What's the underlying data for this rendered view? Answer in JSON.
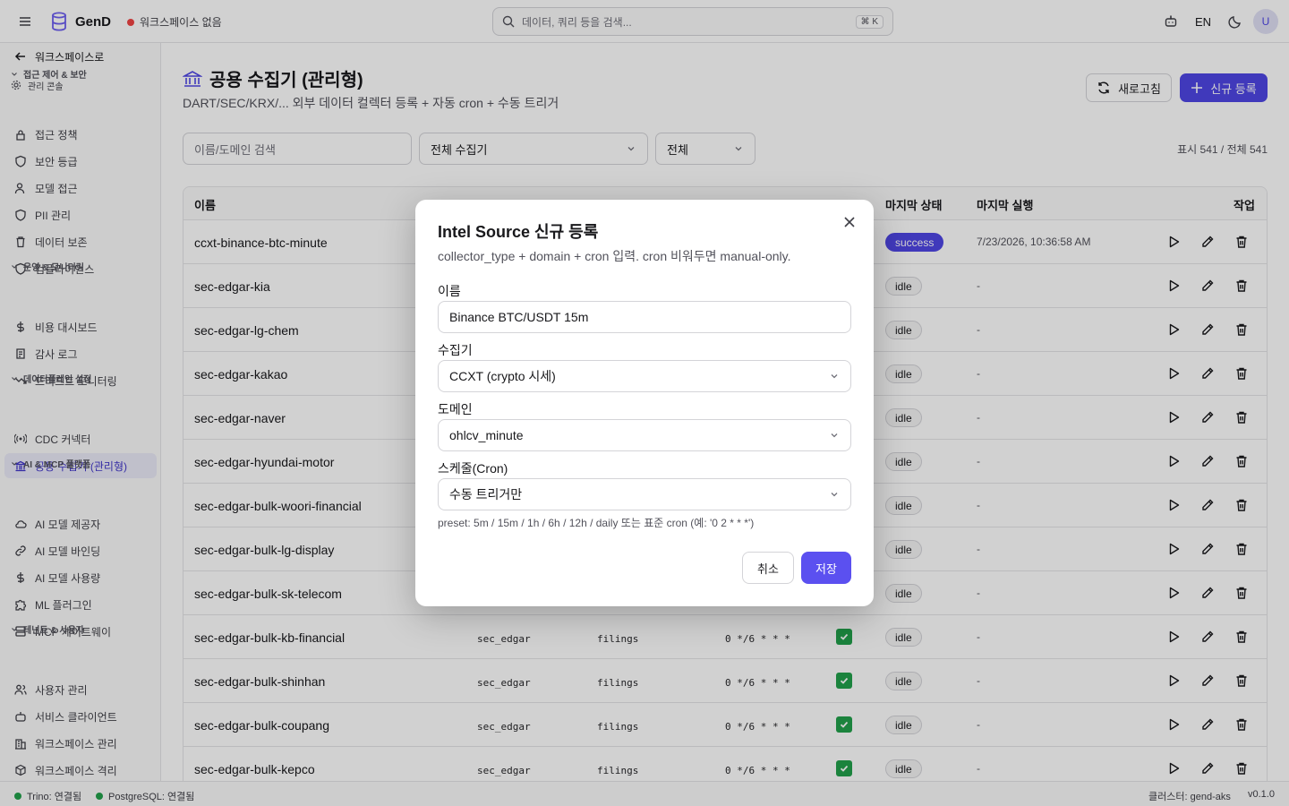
{
  "topbar": {
    "brand": "GenD",
    "workspace": "워크스페이스 없음",
    "search_placeholder": "데이터, 쿼리 등을 검색...",
    "search_shortcut": "⌘ K",
    "lang": "EN",
    "avatar": "U"
  },
  "sidebar": {
    "back": "워크스페이스로",
    "admin_console": "관리 콘솔",
    "sections": [
      {
        "title": "접근 제어 & 보안",
        "items": [
          "접근 정책",
          "보안 등급",
          "모델 접근",
          "PII 관리",
          "데이터 보존",
          "컴플라이언스"
        ]
      },
      {
        "title": "운영 & 모니터링",
        "items": [
          "비용 대시보드",
          "감사 로그",
          "드리프트 모니터링"
        ]
      },
      {
        "title": "데이터플레인 설정",
        "items": [
          "CDC 커넥터",
          "공용 수집기 (관리형)"
        ]
      },
      {
        "title": "AI & MCP 플랫폼",
        "items": [
          "AI 모델 제공자",
          "AI 모델 바인딩",
          "AI 모델 사용량",
          "ML 플러그인",
          "MCP 게이트웨이"
        ]
      },
      {
        "title": "테넌트 & 사용자",
        "items": [
          "사용자 관리",
          "서비스 클라이언트",
          "워크스페이스 관리",
          "워크스페이스 격리"
        ]
      }
    ]
  },
  "page": {
    "title": "공용 수집기 (관리형)",
    "subtitle": "DART/SEC/KRX/... 외부 데이터 컬렉터 등록 + 자동 cron + 수동 트리거",
    "refresh": "새로고침",
    "new": "신규 등록",
    "filter_search_placeholder": "이름/도메인 검색",
    "filter_collector": "전체 수집기",
    "filter_status": "전체",
    "count": "표시 541 / 전체 541"
  },
  "table": {
    "headers": [
      "이름",
      "마지막 상태",
      "마지막 실행",
      "작업"
    ],
    "rows": [
      {
        "name": "ccxt-binance-btc-minute",
        "collector": "",
        "domain": "",
        "cron": "",
        "status": "success",
        "last": "7/23/2026, 10:36:58 AM"
      },
      {
        "name": "sec-edgar-kia",
        "collector": "",
        "domain": "",
        "cron": "",
        "status": "idle",
        "last": "-"
      },
      {
        "name": "sec-edgar-lg-chem",
        "collector": "",
        "domain": "",
        "cron": "",
        "status": "idle",
        "last": "-"
      },
      {
        "name": "sec-edgar-kakao",
        "collector": "",
        "domain": "",
        "cron": "",
        "status": "idle",
        "last": "-"
      },
      {
        "name": "sec-edgar-naver",
        "collector": "",
        "domain": "",
        "cron": "",
        "status": "idle",
        "last": "-"
      },
      {
        "name": "sec-edgar-hyundai-motor",
        "collector": "",
        "domain": "",
        "cron": "",
        "status": "idle",
        "last": "-"
      },
      {
        "name": "sec-edgar-bulk-woori-financial",
        "collector": "",
        "domain": "",
        "cron": "",
        "status": "idle",
        "last": "-"
      },
      {
        "name": "sec-edgar-bulk-lg-display",
        "collector": "",
        "domain": "",
        "cron": "",
        "status": "idle",
        "last": "-"
      },
      {
        "name": "sec-edgar-bulk-sk-telecom",
        "collector": "",
        "domain": "",
        "cron": "",
        "status": "idle",
        "last": "-"
      },
      {
        "name": "sec-edgar-bulk-kb-financial",
        "collector": "sec_edgar",
        "domain": "filings",
        "cron": "0 */6 * * *",
        "status": "idle",
        "last": "-"
      },
      {
        "name": "sec-edgar-bulk-shinhan",
        "collector": "sec_edgar",
        "domain": "filings",
        "cron": "0 */6 * * *",
        "status": "idle",
        "last": "-"
      },
      {
        "name": "sec-edgar-bulk-coupang",
        "collector": "sec_edgar",
        "domain": "filings",
        "cron": "0 */6 * * *",
        "status": "idle",
        "last": "-"
      },
      {
        "name": "sec-edgar-bulk-kepco",
        "collector": "sec_edgar",
        "domain": "filings",
        "cron": "0 */6 * * *",
        "status": "idle",
        "last": "-"
      }
    ]
  },
  "modal": {
    "title": "Intel Source 신규 등록",
    "desc": "collector_type + domain + cron 입력. cron 비워두면 manual-only.",
    "name_label": "이름",
    "name_value": "Binance BTC/USDT 15m",
    "collector_label": "수집기",
    "collector_value": "CCXT (crypto 시세)",
    "domain_label": "도메인",
    "domain_value": "ohlcv_minute",
    "schedule_label": "스케줄(Cron)",
    "schedule_value": "수동 트리거만",
    "help": "preset: 5m / 15m / 1h / 6h / 12h / daily 또는 표준 cron (예: '0 2 * * *')",
    "cancel": "취소",
    "save": "저장"
  },
  "statusbar": {
    "trino": "Trino: 연결됨",
    "postgres": "PostgreSQL: 연결됨",
    "cluster": "클러스터: gend-aks",
    "version": "v0.1.0"
  },
  "colors": {
    "accent": "#4f46e5",
    "danger": "#ef4444",
    "ok": "#22a04b"
  }
}
